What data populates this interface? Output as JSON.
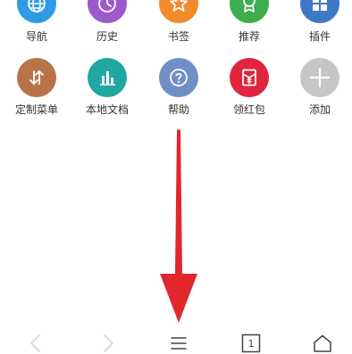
{
  "menu_grid": {
    "row1": [
      {
        "label": "导航",
        "icon": "globe-icon",
        "color": "#2f9be6"
      },
      {
        "label": "历史",
        "icon": "clock-icon",
        "color": "#9b59c9"
      },
      {
        "label": "书签",
        "icon": "star-icon",
        "color": "#f28a2e"
      },
      {
        "label": "推荐",
        "icon": "award-icon",
        "color": "#3fae4e"
      },
      {
        "label": "插件",
        "icon": "grid-icon",
        "color": "#3f78c8"
      }
    ],
    "row2": [
      {
        "label": "定制菜单",
        "icon": "sort-arrows-icon",
        "color": "#b87448"
      },
      {
        "label": "本地文档",
        "icon": "bar-chart-icon",
        "color": "#21a7a1"
      },
      {
        "label": "帮助",
        "icon": "question-icon",
        "color": "#6f8fc6"
      },
      {
        "label": "领红包",
        "icon": "red-envelope-icon",
        "color": "#e0253f"
      },
      {
        "label": "添加",
        "icon": "plus-icon",
        "color": "#c6c6c6"
      }
    ]
  },
  "annotation": {
    "arrow_color": "#e1262c"
  },
  "bottom_bar": {
    "tab_count": "1",
    "back_icon": "chevron-left-icon",
    "forward_icon": "chevron-right-icon",
    "menu_icon": "hamburger-menu-icon",
    "tabs_icon": "tabs-icon",
    "home_icon": "home-icon"
  }
}
